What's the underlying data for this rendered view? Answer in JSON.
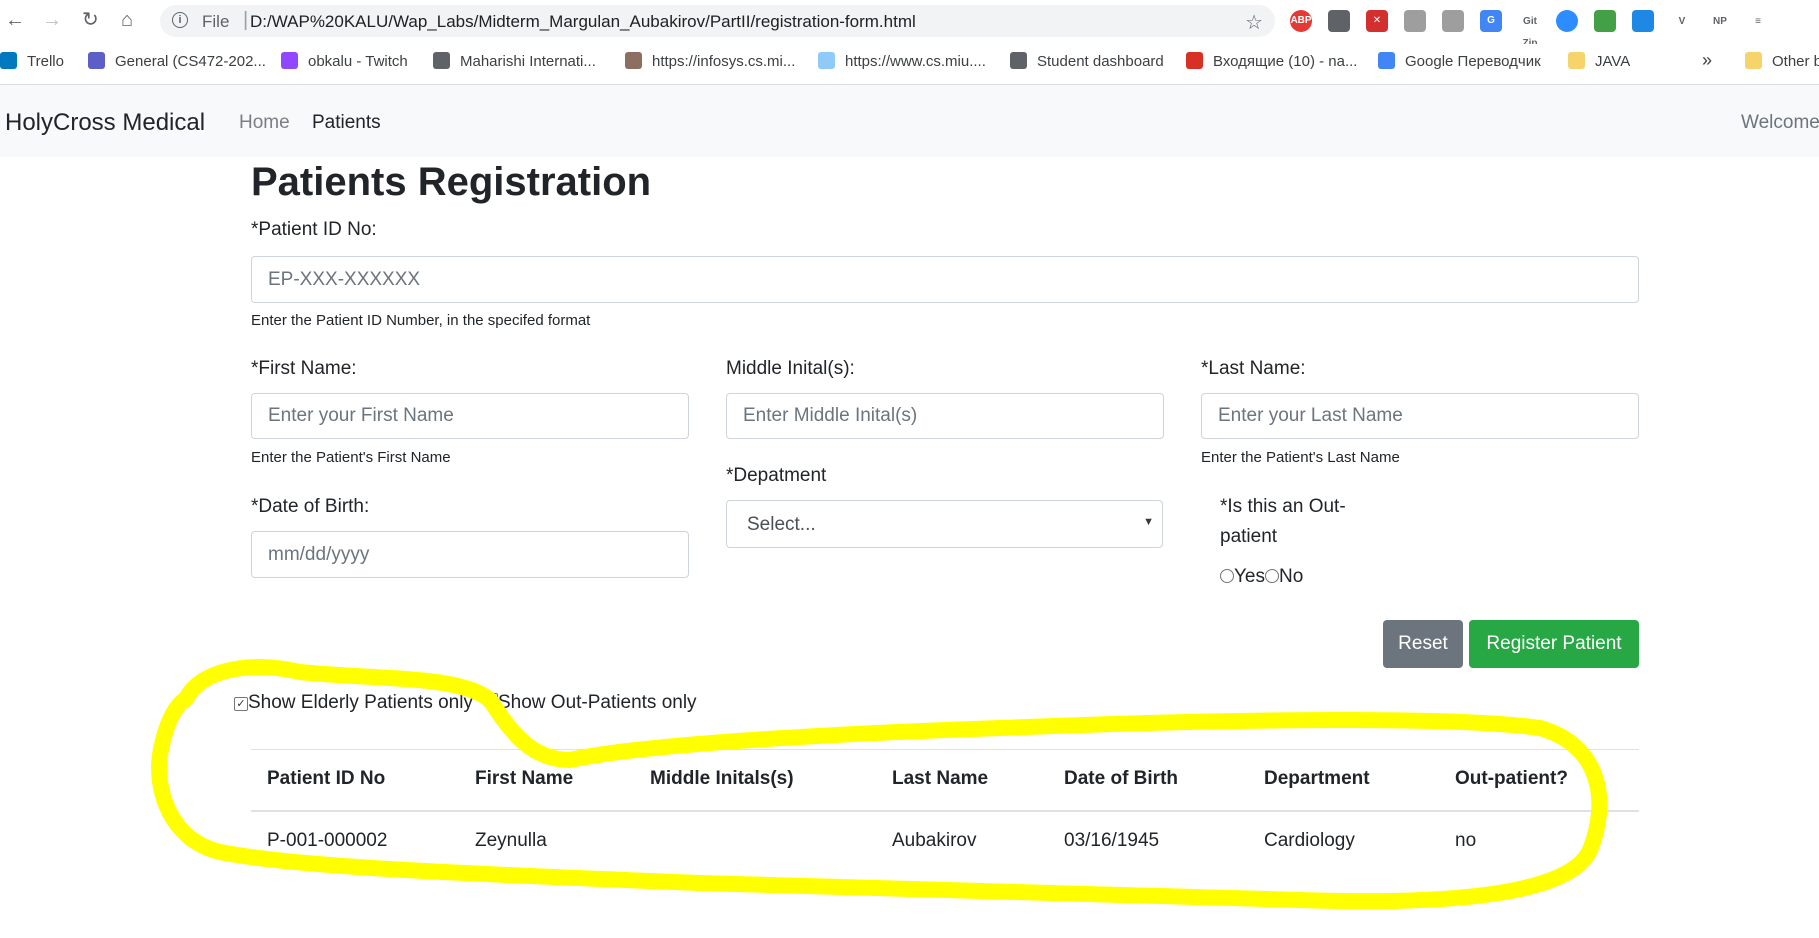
{
  "browser": {
    "url_scheme": "File",
    "url": "D:/WAP%20KALU/Wap_Labs/Midterm_Margulan_Aubakirov/PartII/registration-form.html",
    "extensions": [
      {
        "name": "adblock-plus-icon",
        "label": "ABP",
        "color": "#e53935"
      },
      {
        "name": "extension-circle-icon",
        "label": "",
        "color": "#5f6368"
      },
      {
        "name": "shield-x-icon",
        "label": "✕",
        "color": "#d32f2f"
      },
      {
        "name": "tomato-icon",
        "label": "",
        "color": "#9e9e9e"
      },
      {
        "name": "paw-icon",
        "label": "",
        "color": "#9e9e9e"
      },
      {
        "name": "google-translate-icon",
        "label": "G",
        "color": "#4285f4"
      },
      {
        "name": "gitzip-icon",
        "label": "Git Zip",
        "color": "#ffffff"
      },
      {
        "name": "zoom-icon",
        "label": "",
        "color": "#2d8cff"
      },
      {
        "name": "plant-icon",
        "label": "",
        "color": "#43a047"
      },
      {
        "name": "blue-square-icon",
        "label": "",
        "color": "#1e88e5"
      },
      {
        "name": "vue-devtools-icon",
        "label": "V",
        "color": "#ffffff"
      },
      {
        "name": "np-icon",
        "label": "NP",
        "color": "#ffffff"
      },
      {
        "name": "reading-list-icon",
        "label": "≡",
        "color": "#ffffff"
      }
    ],
    "bookmarks": [
      {
        "label": "Trello",
        "color": "#0079bf"
      },
      {
        "label": "General (CS472-202...",
        "color": "#5b5fc7"
      },
      {
        "label": "obkalu - Twitch",
        "color": "#9146ff"
      },
      {
        "label": "Maharishi Internati...",
        "color": "#5f6368"
      },
      {
        "label": "https://infosys.cs.mi...",
        "color": "#8d6e63"
      },
      {
        "label": "https://www.cs.miu....",
        "color": "#90caf9"
      },
      {
        "label": "Student dashboard",
        "color": "#5f6368"
      },
      {
        "label": "Входящие (10) - na...",
        "color": "#d93025"
      },
      {
        "label": "Google Переводчик",
        "color": "#4285f4"
      },
      {
        "label": "JAVA",
        "color": "#f6d36b"
      }
    ],
    "bookmarks_more": "»",
    "other_bookmarks": "Other b"
  },
  "navbar": {
    "brand": "HolyCross Medical",
    "links": [
      "Home",
      "Patients"
    ],
    "welcome": "Welcome"
  },
  "form": {
    "title": "Patients Registration",
    "patient_id_label": "*Patient ID No:",
    "patient_id_placeholder": "EP-XXX-XXXXXX",
    "patient_id_help": "Enter the Patient ID Number, in the specifed format",
    "first_name_label": "*First Name:",
    "first_name_placeholder": "Enter your First Name",
    "first_name_help": "Enter the Patient's First Name",
    "middle_label": "Middle Inital(s):",
    "middle_placeholder": "Enter Middle Inital(s)",
    "last_name_label": "*Last Name:",
    "last_name_placeholder": "Enter your Last Name",
    "last_name_help": "Enter the Patient's Last Name",
    "dob_label": "*Date of Birth:",
    "dob_placeholder": "mm/dd/yyyy",
    "department_label": "*Depatment",
    "department_selected": "Select...",
    "outpatient_label_line1": "*Is this an Out-",
    "outpatient_label_line2": "patient",
    "yes_label": "Yes",
    "no_label": "No",
    "reset_label": "Reset",
    "register_label": "Register Patient",
    "reset_color": "#6c757d",
    "register_color": "#28a745"
  },
  "filters": {
    "elderly_label": "Show Elderly Patients only",
    "elderly_checked": true,
    "outpatients_label": "Show Out-Patients only",
    "outpatients_checked": false
  },
  "table": {
    "headers": [
      "Patient ID No",
      "First Name",
      "Middle Initals(s)",
      "Last Name",
      "Date of Birth",
      "Department",
      "Out-patient?"
    ],
    "rows": [
      [
        "P-001-000002",
        "Zeynulla",
        "",
        "Aubakirov",
        "03/16/1945",
        "Cardiology",
        "no"
      ]
    ]
  },
  "annotation": {
    "color": "#ffff00"
  }
}
